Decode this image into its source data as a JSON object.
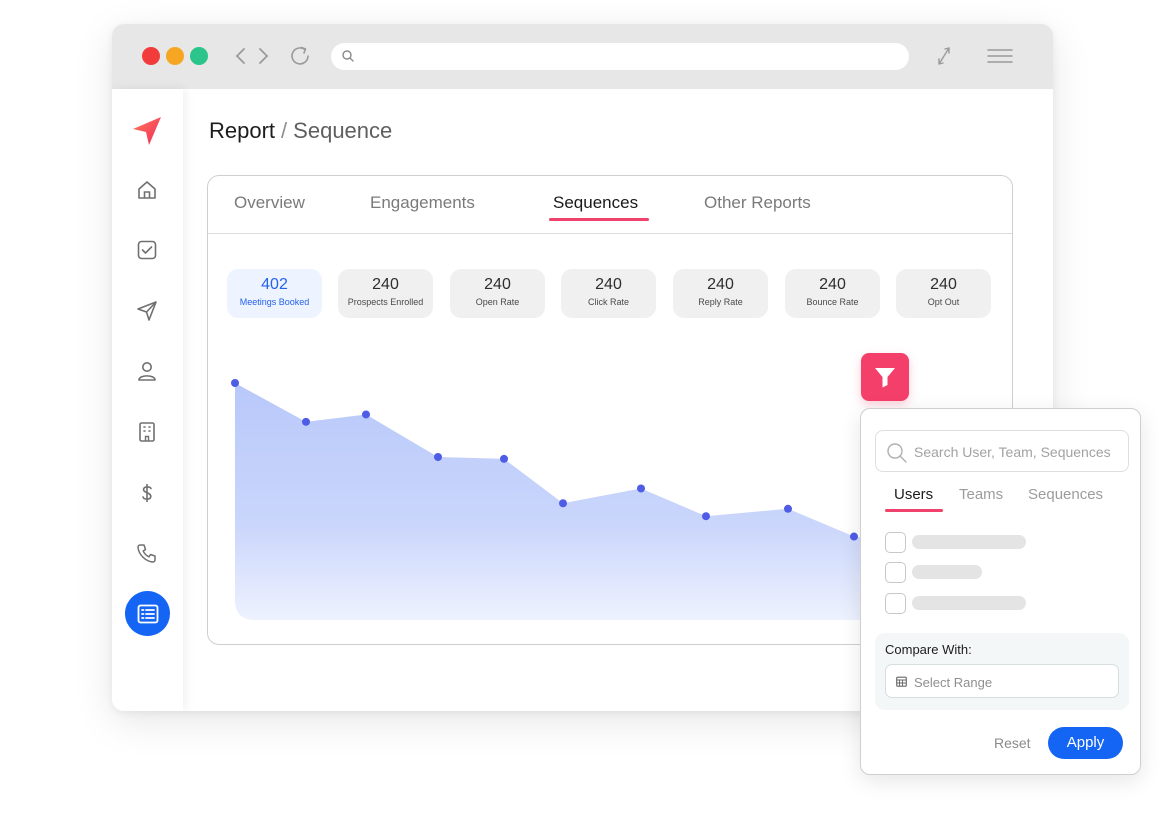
{
  "colors": {
    "accent": "#f0426d",
    "primary": "#1565f5",
    "chart_fill_top": "#c6d3fb",
    "chart_point": "#4f5ce6",
    "dot_red": "#f23b3b",
    "dot_yellow": "#f5a623",
    "dot_green": "#2bc48a"
  },
  "browser": {
    "icons": [
      "back-arrow-icon",
      "forward-arrow-icon",
      "refresh-icon",
      "search-icon",
      "expand-icon",
      "menu-icon"
    ],
    "url_value": ""
  },
  "sidebar": {
    "logo": "paper-plane-logo",
    "items": [
      "home-icon",
      "task-check-icon",
      "send-icon",
      "user-icon",
      "building-icon",
      "dollar-icon",
      "phone-icon",
      "report-list-icon"
    ],
    "active_index": 7
  },
  "breadcrumb": {
    "root": "Report",
    "separator": "/",
    "current": "Sequence"
  },
  "tabs": {
    "items": [
      "Overview",
      "Engagements",
      "Sequences",
      "Other Reports"
    ],
    "active": "Sequences"
  },
  "stats": [
    {
      "value": "402",
      "label": "Meetings  Booked",
      "active": true
    },
    {
      "value": "240",
      "label": "Prospects Enrolled"
    },
    {
      "value": "240",
      "label": "Open Rate"
    },
    {
      "value": "240",
      "label": "Click Rate"
    },
    {
      "value": "240",
      "label": "Reply Rate"
    },
    {
      "value": "240",
      "label": "Bounce Rate"
    },
    {
      "value": "240",
      "label": "Opt Out"
    }
  ],
  "chart_data": {
    "type": "area",
    "values": [
      100,
      79,
      83,
      60,
      59,
      35,
      43,
      28,
      32,
      17
    ],
    "ylim": [
      0,
      100
    ],
    "points_visible": true
  },
  "filter": {
    "icon": "funnel-icon",
    "search_placeholder": "Search User, Team, Sequences",
    "search_value": "",
    "tabs": [
      "Users",
      "Teams",
      "Sequences"
    ],
    "active_tab": "Users",
    "options": [
      {
        "checked": false,
        "loading": true
      },
      {
        "checked": false,
        "loading": true
      },
      {
        "checked": false,
        "loading": true
      }
    ],
    "compare_label": "Compare With:",
    "range_placeholder": "Select Range",
    "range_value": "",
    "range_icon": "calendar-icon",
    "reset_label": "Reset",
    "apply_label": "Apply"
  }
}
